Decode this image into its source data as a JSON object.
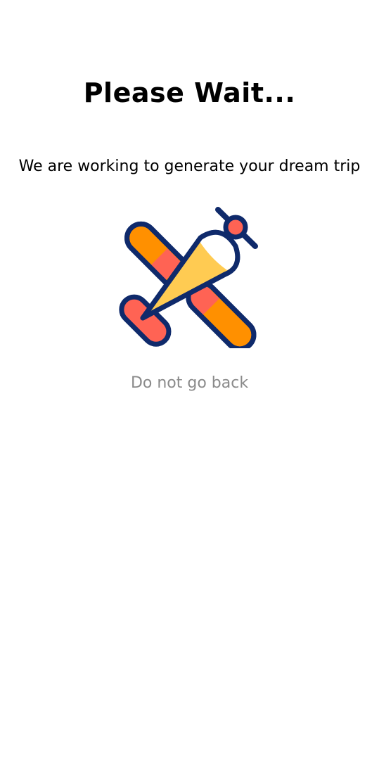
{
  "loading_screen": {
    "title": "Please Wait...",
    "subtitle": "We are working to generate your dream trip",
    "illustration_icon": "airplane-icon",
    "note": "Do not go back"
  },
  "colors": {
    "title": "#000000",
    "subtitle": "#000000",
    "note": "#8a8a8a",
    "outline": "#0f2a6b",
    "wing_orange": "#ff9000",
    "wing_red": "#ff6354",
    "cone_yellow": "#ffcb52",
    "nose_white": "#ffffff"
  }
}
